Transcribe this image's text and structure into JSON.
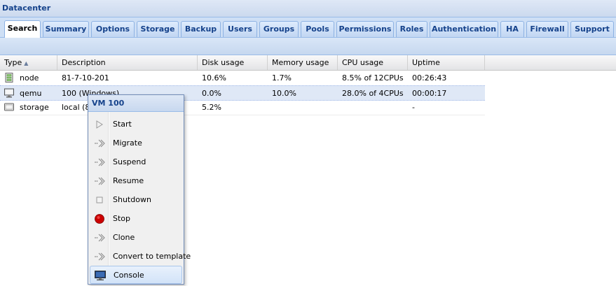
{
  "panel": {
    "title": "Datacenter"
  },
  "tabs": [
    "Search",
    "Summary",
    "Options",
    "Storage",
    "Backup",
    "Users",
    "Groups",
    "Pools",
    "Permissions",
    "Roles",
    "Authentication",
    "HA",
    "Firewall",
    "Support"
  ],
  "active_tab": "Search",
  "grid": {
    "columns": [
      "Type",
      "Description",
      "Disk usage",
      "Memory usage",
      "CPU usage",
      "Uptime"
    ],
    "rows": [
      {
        "type": "node",
        "icon": "server-icon",
        "description": "81-7-10-201",
        "disk": "10.6%",
        "memory": "1.7%",
        "cpu": "8.5% of 12CPUs",
        "uptime": "00:26:43"
      },
      {
        "type": "qemu",
        "icon": "monitor-icon",
        "description": "100 (Windows)",
        "disk": "0.0%",
        "memory": "10.0%",
        "cpu": "28.0% of 4CPUs",
        "uptime": "00:00:17"
      },
      {
        "type": "storage",
        "icon": "storage-icon",
        "description": "local (8",
        "disk": "5.2%",
        "memory": "",
        "cpu": "",
        "uptime": "-"
      }
    ]
  },
  "context_menu": {
    "title": "VM 100",
    "items": [
      {
        "label": "Start",
        "icon": "play-icon"
      },
      {
        "label": "Migrate",
        "icon": "migrate-icon"
      },
      {
        "label": "Suspend",
        "icon": "suspend-icon"
      },
      {
        "label": "Resume",
        "icon": "resume-icon"
      },
      {
        "label": "Shutdown",
        "icon": "shutdown-icon"
      },
      {
        "label": "Stop",
        "icon": "stop-icon"
      },
      {
        "label": "Clone",
        "icon": "clone-icon"
      },
      {
        "label": "Convert to template",
        "icon": "template-icon"
      },
      {
        "label": "Console",
        "icon": "console-icon"
      }
    ],
    "active_item": "Console"
  },
  "colors": {
    "header_text": "#15428b",
    "selected_row": "#dfe8f6",
    "stop_red": "#cc0000"
  }
}
